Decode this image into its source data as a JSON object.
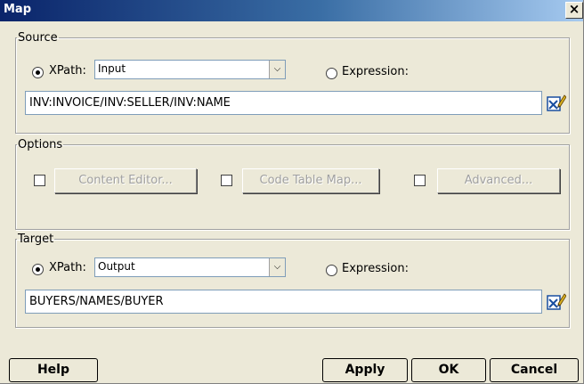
{
  "window": {
    "title": "Map",
    "close_glyph": "×"
  },
  "source": {
    "legend": "Source",
    "xpath_label": "XPath:",
    "xpath_selected": true,
    "xpath_value": "Input",
    "expression_label": "Expression:",
    "expression_selected": false,
    "path_value": "INV:INVOICE/INV:SELLER/INV:NAME",
    "edit_icon": "edit-xpath-icon"
  },
  "options": {
    "legend": "Options",
    "content_editor_label": "Content Editor...",
    "content_editor_checked": false,
    "code_table_map_label": "Code Table Map...",
    "code_table_map_checked": false,
    "advanced_label": "Advanced...",
    "advanced_checked": false
  },
  "target": {
    "legend": "Target",
    "xpath_label": "XPath:",
    "xpath_selected": true,
    "xpath_value": "Output",
    "expression_label": "Expression:",
    "expression_selected": false,
    "path_value": "BUYERS/NAMES/BUYER",
    "edit_icon": "edit-xpath-icon"
  },
  "footer": {
    "help_label": "Help",
    "apply_label": "Apply",
    "ok_label": "OK",
    "cancel_label": "Cancel"
  },
  "colors": {
    "dialog_background": "#ece9d8",
    "title_gradient_start": "#0a246a",
    "title_gradient_end": "#a6caf0"
  }
}
